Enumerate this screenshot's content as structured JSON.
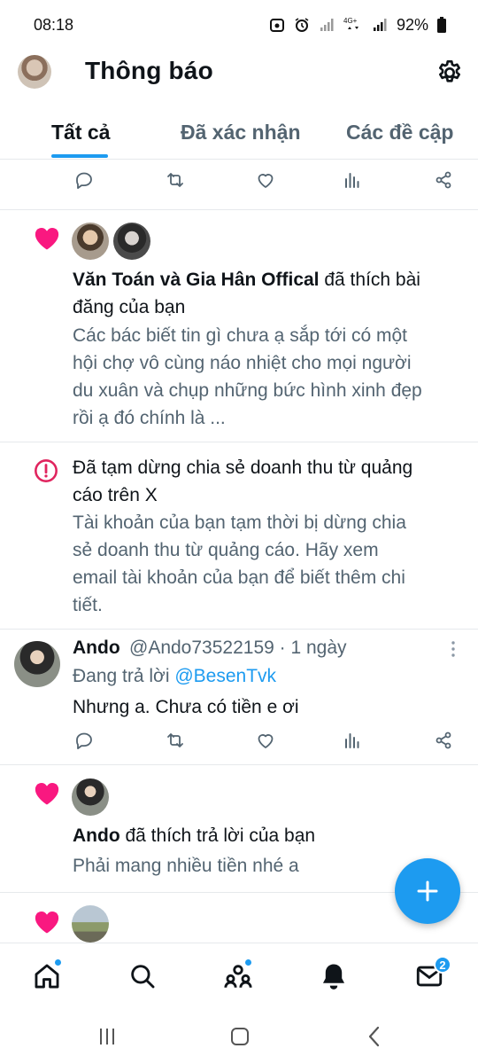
{
  "status_bar": {
    "time": "08:18",
    "network_label": "4G+",
    "battery": "92%"
  },
  "header": {
    "title": "Thông báo"
  },
  "tabs": [
    {
      "label": "Tất cả",
      "active": true
    },
    {
      "label": "Đã xác nhận",
      "active": false
    },
    {
      "label": "Các đề cập",
      "active": false
    }
  ],
  "notifications": {
    "like_post": {
      "names": "Văn Toán và Gia Hân Offical",
      "action": " đã thích bài đăng của bạn",
      "line1_bold": "Văn Toán và Gia Hân Offical",
      "line1_rest": " đã thích bài",
      "line2": "đăng của bạn",
      "body_lines": [
        "Các bác biết tin gì chưa ạ sắp tới có một",
        "hội chợ vô cùng náo nhiệt cho mọi người",
        "du xuân và chụp những bức hình xinh đẹp",
        "rồi ạ đó chính là ..."
      ]
    },
    "alert": {
      "title_lines": [
        "Đã tạm dừng chia sẻ doanh thu từ quảng",
        "cáo trên X"
      ],
      "body_lines": [
        "Tài khoản của bạn tạm thời bị dừng chia",
        "sẻ doanh thu từ quảng cáo. Hãy xem",
        "email tài khoản của bạn để biết thêm chi",
        "tiết."
      ]
    },
    "reply": {
      "name": "Ando",
      "handle_time": "@Ando73522159 · 1 ngày",
      "replying_to_label": "Đang trả lời ",
      "replying_to_handle": "@BesenTvk",
      "text": "Nhưng a. Chưa có tiền e ơi"
    },
    "like_reply": {
      "name": "Ando",
      "action": " đã thích trả lời của bạn",
      "body": "Phải mang nhiều tiền nhé a"
    }
  },
  "bottom_nav": {
    "items": [
      "home",
      "search",
      "communities",
      "notifications",
      "messages"
    ],
    "messages_badge": "2"
  },
  "colors": {
    "accent": "#1d9bf0",
    "heart": "#f91880",
    "alert": "#e0245e",
    "secondary_text": "#536471"
  }
}
